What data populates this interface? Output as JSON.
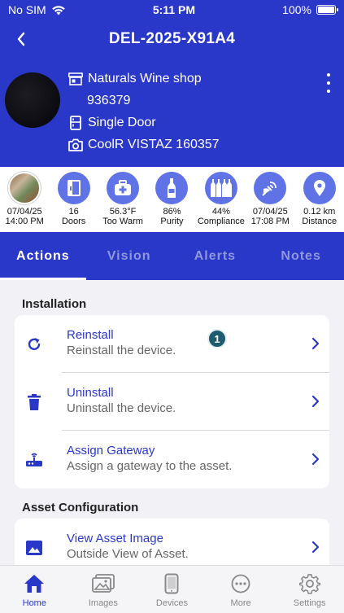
{
  "status_bar": {
    "carrier": "No SIM",
    "time": "5:11 PM",
    "battery": "100%",
    "battery_level": 1.0
  },
  "nav": {
    "title": "DEL-2025-X91A4"
  },
  "asset": {
    "store_name": "Naturals Wine shop",
    "store_code": "936379",
    "door_type": "Single Door",
    "device": "CoolR VISTAZ  160357"
  },
  "stats": [
    {
      "value": "07/04/25",
      "label": "14:00 PM",
      "icon": "store-photo"
    },
    {
      "value": "16",
      "label": "Doors",
      "icon": "door-icon"
    },
    {
      "value": "56.3°F",
      "label": "Too Warm",
      "icon": "first-aid-icon"
    },
    {
      "value": "86%",
      "label": "Purity",
      "icon": "bottle-icon"
    },
    {
      "value": "44%",
      "label": "Compliance",
      "icon": "bottles-icon"
    },
    {
      "value": "07/04/25",
      "label": "17:08 PM",
      "icon": "satellite-icon"
    },
    {
      "value": "0.12 km",
      "label": "Distance",
      "icon": "location-icon"
    }
  ],
  "tabs": [
    "Actions",
    "Vision",
    "Alerts",
    "Notes"
  ],
  "sections": {
    "installation": {
      "title": "Installation",
      "items": [
        {
          "title": "Reinstall",
          "subtitle": "Reinstall the device.",
          "icon": "refresh-icon"
        },
        {
          "title": "Uninstall",
          "subtitle": "Uninstall the device.",
          "icon": "trash-icon"
        },
        {
          "title": "Assign Gateway",
          "subtitle": "Assign a gateway to the asset.",
          "icon": "router-icon"
        }
      ]
    },
    "asset_configuration": {
      "title": "Asset Configuration",
      "items": [
        {
          "title": "View Asset Image",
          "subtitle": "Outside View of Asset.",
          "icon": "image-icon"
        }
      ]
    }
  },
  "badge": "1",
  "bottom_nav": [
    {
      "label": "Home",
      "icon": "home-icon",
      "active": true
    },
    {
      "label": "Images",
      "icon": "images-icon"
    },
    {
      "label": "Devices",
      "icon": "phone-icon"
    },
    {
      "label": "More",
      "icon": "more-icon"
    },
    {
      "label": "Settings",
      "icon": "gear-icon"
    }
  ],
  "colors": {
    "primary": "#2a38c9",
    "stat_circle": "#5f73e6",
    "badge": "#1d5b70"
  }
}
